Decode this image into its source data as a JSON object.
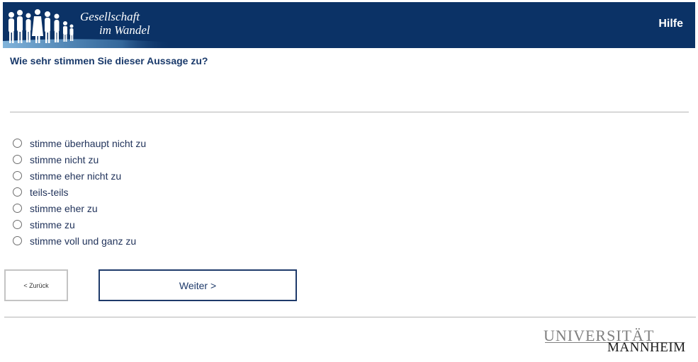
{
  "header": {
    "brand_line1": "Gesellschaft",
    "brand_line2": "im Wandel",
    "help_label": "Hilfe",
    "background_color": "#0b3266"
  },
  "question": {
    "text": "Wie sehr stimmen Sie dieser Aussage zu?"
  },
  "options": [
    {
      "label": "stimme überhaupt nicht zu",
      "selected": false
    },
    {
      "label": "stimme nicht zu",
      "selected": false
    },
    {
      "label": "stimme eher nicht zu",
      "selected": false
    },
    {
      "label": "teils-teils",
      "selected": false
    },
    {
      "label": "stimme eher zu",
      "selected": false
    },
    {
      "label": "stimme zu",
      "selected": false
    },
    {
      "label": "stimme voll und ganz zu",
      "selected": false
    }
  ],
  "nav": {
    "back_label": "< Zurück",
    "next_label": "Weiter >"
  },
  "footer": {
    "logo_line1": "UNIVERSITÄT",
    "logo_line2": "MANNHEIM"
  }
}
